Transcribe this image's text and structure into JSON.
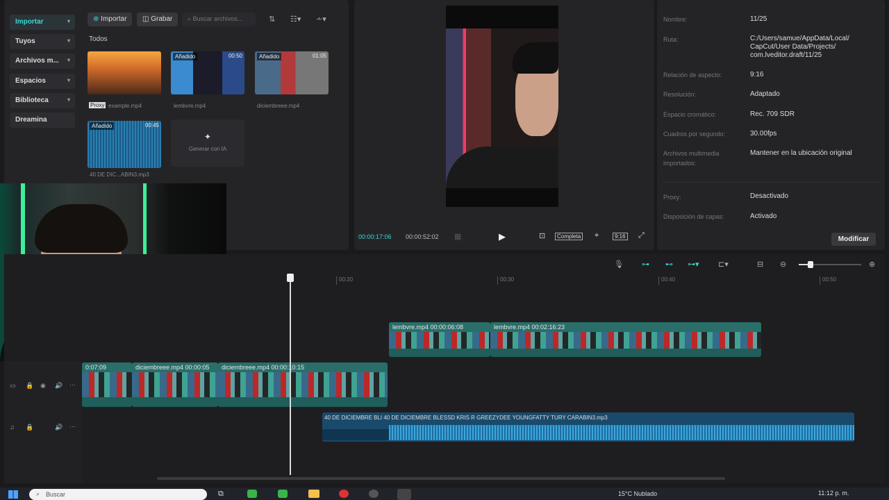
{
  "media": {
    "sidebar": [
      {
        "label": "Importar",
        "active": true
      },
      {
        "label": "Tuyos"
      },
      {
        "label": "Archivos m..."
      },
      {
        "label": "Espacios"
      },
      {
        "label": "Biblioteca"
      },
      {
        "label": "Dreamina"
      }
    ],
    "import_btn": "Importar",
    "record_btn": "Grabar",
    "search_placeholder": "Buscar archivos...",
    "section_title": "Todos",
    "items": [
      {
        "name": "example.mp4",
        "proxy": "Proxy",
        "tag": "",
        "duration": ""
      },
      {
        "name": "lembvre.mp4",
        "tag": "Añadido",
        "duration": "00:50"
      },
      {
        "name": "diciembreee.mp4",
        "tag": "Añadido",
        "duration": "01:05"
      },
      {
        "name": "40 DE DIC...ABIN3.mp3",
        "tag": "Añadido",
        "duration": "00:45"
      }
    ],
    "ai_generate": "Generar con IA"
  },
  "player": {
    "current_time": "00:00:17:06",
    "total_time": "00:00:52:02",
    "fit_label": "Completa",
    "ratio_label": "9:16"
  },
  "details": {
    "rows": [
      {
        "label": "Nombre:",
        "value": "11/25"
      },
      {
        "label": "Ruta:",
        "value": "C:/Users/samue/AppData/Local/ CapCut/User Data/Projects/ com.lveditor.draft/11/25"
      },
      {
        "label": "Relación de aspecto:",
        "value": "9:16"
      },
      {
        "label": "Resolución:",
        "value": "Adaptado"
      },
      {
        "label": "Espacio cromático:",
        "value": "Rec. 709 SDR"
      },
      {
        "label": "Cuadros por segundo:",
        "value": "30.00fps"
      },
      {
        "label": "Archivos multimedia importados:",
        "value": "Mantener en la ubicación original"
      },
      {
        "label": "Proxy:",
        "value": "Desactivado"
      },
      {
        "label": "Disposición de capas:",
        "value": "Activado"
      }
    ],
    "modify_btn": "Modificar"
  },
  "timeline": {
    "ruler": [
      "00:20",
      "00:30",
      "00:40",
      "00:50"
    ],
    "clips_top": [
      {
        "label": "lembvre.mp4   00:00:06:08"
      },
      {
        "label": "lembvre.mp4   00:02:16:23"
      }
    ],
    "clips_main": [
      {
        "label": "0:07:09"
      },
      {
        "label": "diciembreee.mp4   00:00:05"
      },
      {
        "label": "diciembreee.mp4   00:00:10:15"
      }
    ],
    "audio_clip": "40 DE DICIEMBRE  BLI   40 DE DICIEMBRE  BLESSD  KRIS R  GREEZYDEE  YOUNGFATTY  TURY  CARABIN3.mp3"
  },
  "taskbar": {
    "search_placeholder": "Buscar",
    "weather": "15°C  Nublado",
    "time": "11:12 p. m."
  },
  "colors": {
    "accent": "#3fd6d3",
    "bg": "#1a1a1c",
    "panel": "#242427",
    "clip": "#1f5e5a",
    "audio": "#1a4a6b"
  }
}
